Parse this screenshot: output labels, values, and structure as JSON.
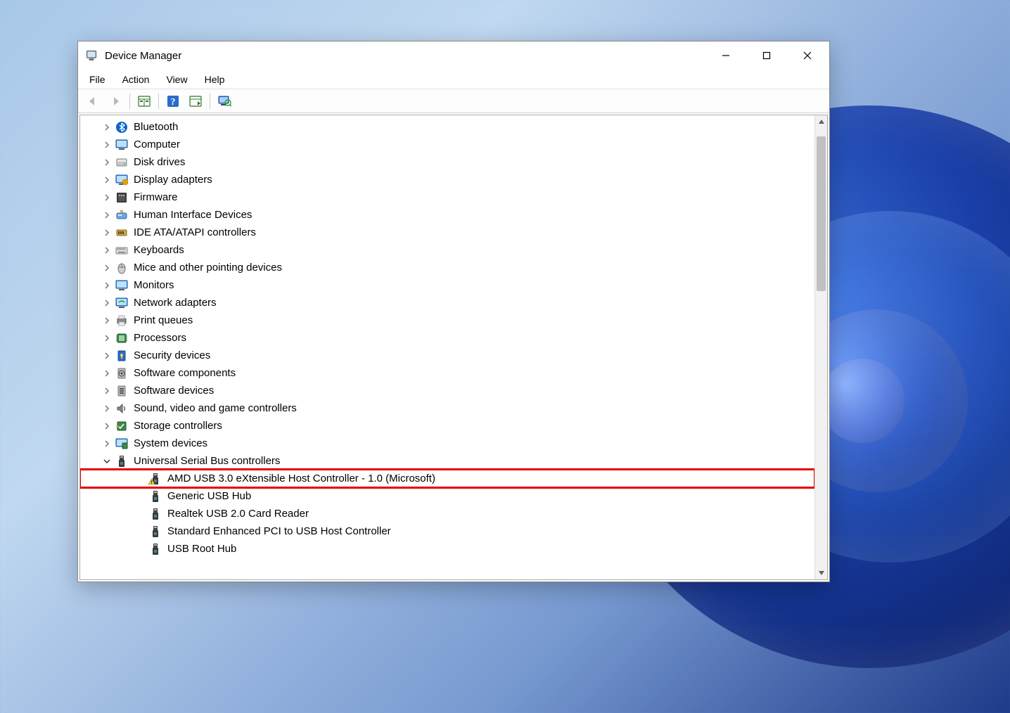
{
  "window": {
    "title": "Device Manager",
    "menus": {
      "file": "File",
      "action": "Action",
      "view": "View",
      "help": "Help"
    }
  },
  "tree": {
    "categories": [
      {
        "label": "Bluetooth",
        "icon": "bluetooth",
        "expanded": false
      },
      {
        "label": "Computer",
        "icon": "computer",
        "expanded": false
      },
      {
        "label": "Disk drives",
        "icon": "disk",
        "expanded": false
      },
      {
        "label": "Display adapters",
        "icon": "display",
        "expanded": false
      },
      {
        "label": "Firmware",
        "icon": "firmware",
        "expanded": false
      },
      {
        "label": "Human Interface Devices",
        "icon": "hid",
        "expanded": false
      },
      {
        "label": "IDE ATA/ATAPI controllers",
        "icon": "ide",
        "expanded": false
      },
      {
        "label": "Keyboards",
        "icon": "keyboard",
        "expanded": false
      },
      {
        "label": "Mice and other pointing devices",
        "icon": "mouse",
        "expanded": false
      },
      {
        "label": "Monitors",
        "icon": "monitor",
        "expanded": false
      },
      {
        "label": "Network adapters",
        "icon": "network",
        "expanded": false
      },
      {
        "label": "Print queues",
        "icon": "printer",
        "expanded": false
      },
      {
        "label": "Processors",
        "icon": "cpu",
        "expanded": false
      },
      {
        "label": "Security devices",
        "icon": "security",
        "expanded": false
      },
      {
        "label": "Software components",
        "icon": "swcomp",
        "expanded": false
      },
      {
        "label": "Software devices",
        "icon": "swdev",
        "expanded": false
      },
      {
        "label": "Sound, video and game controllers",
        "icon": "sound",
        "expanded": false
      },
      {
        "label": "Storage controllers",
        "icon": "storage",
        "expanded": false
      },
      {
        "label": "System devices",
        "icon": "system",
        "expanded": false
      },
      {
        "label": "Universal Serial Bus controllers",
        "icon": "usb",
        "expanded": true,
        "children": [
          {
            "label": "AMD USB 3.0 eXtensible Host Controller - 1.0 (Microsoft)",
            "icon": "usb",
            "warning": true,
            "highlighted": true
          },
          {
            "label": "Generic USB Hub",
            "icon": "usb"
          },
          {
            "label": "Realtek USB 2.0 Card Reader",
            "icon": "usb"
          },
          {
            "label": "Standard Enhanced PCI to USB Host Controller",
            "icon": "usb"
          },
          {
            "label": "USB Root Hub",
            "icon": "usb"
          }
        ]
      }
    ]
  }
}
